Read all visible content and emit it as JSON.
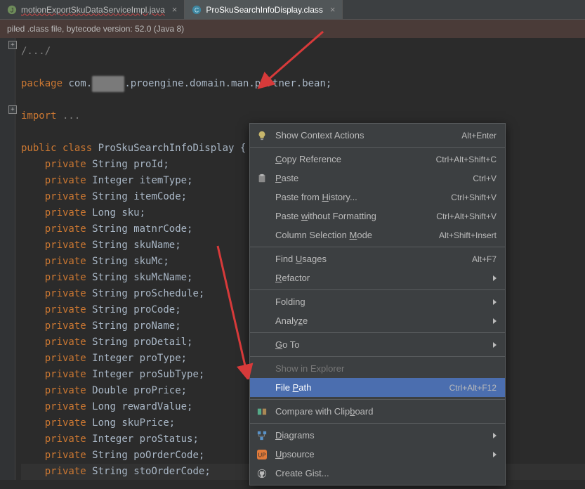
{
  "tabs": [
    {
      "label": "motionExportSkuDataServiceImpl.java",
      "type": "java",
      "active": false
    },
    {
      "label": "ProSkuSearchInfoDisplay.class",
      "type": "class",
      "active": true
    }
  ],
  "status": "piled .class file, bytecode version: 52.0 (Java 8)",
  "code": {
    "fold_label": "/.../",
    "package_kw": "package",
    "package_pre": " com.",
    "redacted": "xxxxx",
    "package_post": ".proengine.domain.man.partner.bean;",
    "import_kw": "import",
    "import_rest": " ...",
    "classdef_pre": "public class",
    "classdef_name": " ProSkuSearchInfoDisplay ",
    "classdef_post": "{",
    "fields": [
      {
        "mod": "private",
        "type": "String",
        "name": "proId"
      },
      {
        "mod": "private",
        "type": "Integer",
        "name": "itemType"
      },
      {
        "mod": "private",
        "type": "String",
        "name": "itemCode"
      },
      {
        "mod": "private",
        "type": "Long",
        "name": "sku"
      },
      {
        "mod": "private",
        "type": "String",
        "name": "matnrCode"
      },
      {
        "mod": "private",
        "type": "String",
        "name": "skuName"
      },
      {
        "mod": "private",
        "type": "String",
        "name": "skuMc"
      },
      {
        "mod": "private",
        "type": "String",
        "name": "skuMcName"
      },
      {
        "mod": "private",
        "type": "String",
        "name": "proSchedule"
      },
      {
        "mod": "private",
        "type": "String",
        "name": "proCode"
      },
      {
        "mod": "private",
        "type": "String",
        "name": "proName"
      },
      {
        "mod": "private",
        "type": "String",
        "name": "proDetail"
      },
      {
        "mod": "private",
        "type": "Integer",
        "name": "proType"
      },
      {
        "mod": "private",
        "type": "Integer",
        "name": "proSubType"
      },
      {
        "mod": "private",
        "type": "Double",
        "name": "proPrice"
      },
      {
        "mod": "private",
        "type": "Long",
        "name": "rewardValue"
      },
      {
        "mod": "private",
        "type": "Long",
        "name": "skuPrice"
      },
      {
        "mod": "private",
        "type": "Integer",
        "name": "proStatus"
      },
      {
        "mod": "private",
        "type": "String",
        "name": "poOrderCode"
      },
      {
        "mod": "private",
        "type": "String",
        "name": "stoOrderCode"
      }
    ]
  },
  "menu": {
    "groups": [
      [
        {
          "icon": "bulb",
          "label_pre": "Show Context Actions",
          "shortcut": "Alt+Enter",
          "has_sub": false
        }
      ],
      [
        {
          "icon": "",
          "label_pre": "",
          "mn": "C",
          "label_post": "opy Reference",
          "shortcut": "Ctrl+Alt+Shift+C",
          "has_sub": false
        },
        {
          "icon": "paste",
          "mn": "P",
          "label_post": "aste",
          "shortcut": "Ctrl+V",
          "has_sub": false
        },
        {
          "icon": "",
          "label_pre": "Paste from ",
          "mn": "H",
          "label_post": "istory...",
          "shortcut": "Ctrl+Shift+V",
          "has_sub": false
        },
        {
          "icon": "",
          "label_pre": "Paste ",
          "mn": "w",
          "label_post": "ithout Formatting",
          "shortcut": "Ctrl+Alt+Shift+V",
          "has_sub": false
        },
        {
          "icon": "",
          "label_pre": "Column Selection ",
          "mn": "M",
          "label_post": "ode",
          "shortcut": "Alt+Shift+Insert",
          "has_sub": false
        }
      ],
      [
        {
          "icon": "",
          "label_pre": "Find ",
          "mn": "U",
          "label_post": "sages",
          "shortcut": "Alt+F7",
          "has_sub": false
        },
        {
          "icon": "",
          "mn": "R",
          "label_post": "efactor",
          "has_sub": true
        }
      ],
      [
        {
          "icon": "",
          "label_pre": "Foldin",
          "mn": "g",
          "has_sub": true
        },
        {
          "icon": "",
          "label_pre": "Analy",
          "mn": "z",
          "label_post": "e",
          "has_sub": true
        }
      ],
      [
        {
          "icon": "",
          "mn": "G",
          "label_post": "o To",
          "has_sub": true
        }
      ],
      [
        {
          "icon": "",
          "label_pre": "Show in Explorer",
          "has_sub": false,
          "disabled": true
        },
        {
          "icon": "",
          "label_pre": "File ",
          "mn": "P",
          "label_post": "ath",
          "shortcut": "Ctrl+Alt+F12",
          "has_sub": false,
          "highlight": true
        }
      ],
      [
        {
          "icon": "compare",
          "label_pre": "Compare with Clip",
          "mn": "b",
          "label_post": "oard",
          "has_sub": false
        }
      ],
      [
        {
          "icon": "diagram",
          "mn": "D",
          "label_post": "iagrams",
          "has_sub": true
        },
        {
          "icon": "upsource",
          "label_pre": "",
          "mn": "U",
          "label_post": "psource",
          "has_sub": true
        },
        {
          "icon": "github",
          "label_pre": "Create Gist...",
          "has_sub": false
        }
      ]
    ]
  }
}
